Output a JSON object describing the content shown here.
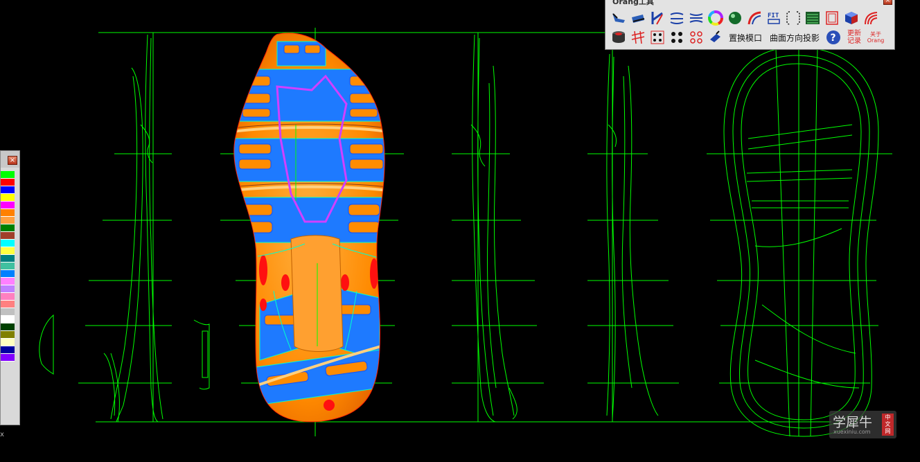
{
  "toolbar": {
    "title": "Orang工具",
    "replace_mold_label": "置换模口",
    "surface_projection_label": "曲面方向投影",
    "update_log_label": "更新记录",
    "about_label": "关于Orang",
    "fit_label": "FIT",
    "icons": [
      "shoe-tool-icon",
      "sole-tool-icon",
      "curve-cut-icon",
      "arc-lines-icon",
      "arc-lines-2-icon",
      "color-wheel-icon",
      "sphere-icon",
      "curve-arc-icon",
      "fit-icon",
      "bracket-icon",
      "grid-data-icon",
      "frame-icon",
      "cube-icon",
      "rainbow-arc-icon",
      "cylinder-icon",
      "grid-lines-icon",
      "dots-grid-icon",
      "dots-array-icon",
      "circle-array-icon",
      "bend-tool-icon",
      "help-icon"
    ]
  },
  "palette": {
    "colors": [
      "#00ff00",
      "#ff0000",
      "#0000ff",
      "#ffff00",
      "#ff00ff",
      "#ff8000",
      "#ffa040",
      "#008000",
      "#a0402a",
      "#00ffff",
      "#ffff40",
      "#008080",
      "#40c0a0",
      "#0080ff",
      "#ff80ff",
      "#c080ff",
      "#ff80c0",
      "#ff8080",
      "#c0c0c0",
      "#ffffff",
      "#004000",
      "#808000",
      "#ffffc0",
      "#0000a0",
      "#8000ff"
    ]
  },
  "coord_label": "x",
  "watermark": {
    "cn": "学犀牛",
    "url": "xuexiniu.com",
    "badge": "中文网"
  },
  "viewport": {
    "curve_color": "#00ff00",
    "sole_orange": "#ff8c00",
    "sole_blue": "#1e7aff"
  }
}
